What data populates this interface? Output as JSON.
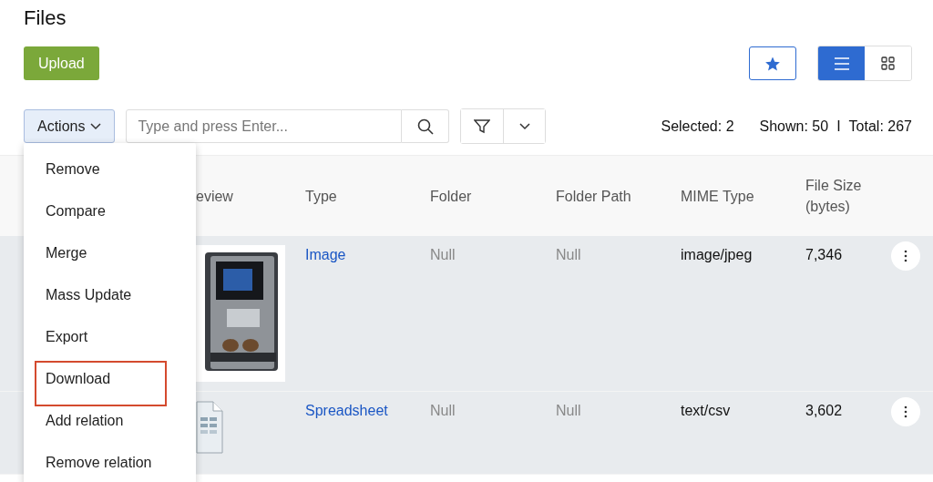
{
  "title": "Files",
  "upload_button": "Upload",
  "favorite": {
    "selected": false
  },
  "view_toggle": [
    {
      "kind": "list",
      "selected": true
    },
    {
      "kind": "grid",
      "selected": false
    }
  ],
  "actions_button": "Actions",
  "search": {
    "placeholder": "Type and press Enter..."
  },
  "counts": {
    "selected": "Selected: 2",
    "shown": "Shown: 50",
    "separator": "I",
    "total": "Total: 267"
  },
  "actions_menu": [
    {
      "label": "Remove",
      "highlighted": false
    },
    {
      "label": "Compare",
      "highlighted": false
    },
    {
      "label": "Merge",
      "highlighted": false
    },
    {
      "label": "Mass Update",
      "highlighted": false
    },
    {
      "label": "Export",
      "highlighted": false
    },
    {
      "label": "Download",
      "highlighted": true
    },
    {
      "label": "Add relation",
      "highlighted": false
    },
    {
      "label": "Remove relation",
      "highlighted": false
    }
  ],
  "table": {
    "columns": [
      "eview",
      "Type",
      "Folder",
      "Folder Path",
      "MIME Type",
      "File Size (bytes)"
    ],
    "rows": [
      {
        "selected": true,
        "type": "Image",
        "folder": "Null",
        "folder_path": "Null",
        "mime_type": "image/jpeg",
        "file_size": "7,346"
      },
      {
        "selected": true,
        "preview": {
          "kind": "file"
        },
        "type": "Spreadsheet",
        "folder": "Null",
        "folder_path": "Null",
        "mime_type": "text/csv",
        "file_size": "3,602"
      }
    ]
  }
}
